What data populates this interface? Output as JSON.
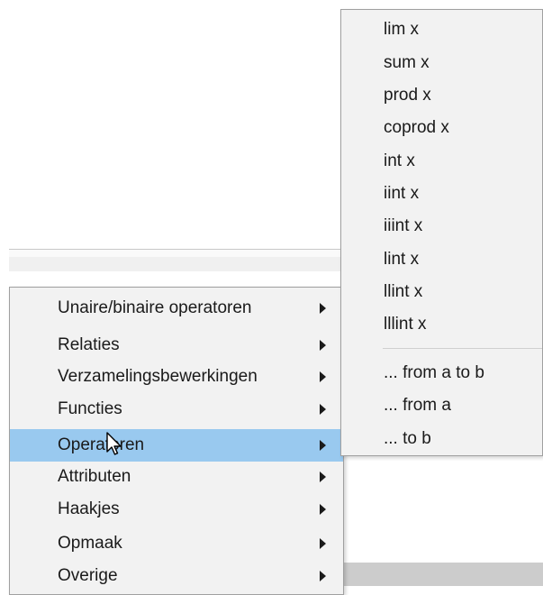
{
  "main_menu": {
    "items": [
      {
        "label": "Unaire/binaire operatoren",
        "has_submenu": true,
        "highlighted": false
      },
      {
        "label": "Relaties",
        "has_submenu": true,
        "highlighted": false
      },
      {
        "label": "Verzamelingsbewerkingen",
        "has_submenu": true,
        "highlighted": false
      },
      {
        "label": "Functies",
        "has_submenu": true,
        "highlighted": false
      },
      {
        "label": "Operatoren",
        "has_submenu": true,
        "highlighted": true
      },
      {
        "label": "Attributen",
        "has_submenu": true,
        "highlighted": false
      },
      {
        "label": "Haakjes",
        "has_submenu": true,
        "highlighted": false
      },
      {
        "label": "Opmaak",
        "has_submenu": true,
        "highlighted": false
      },
      {
        "label": "Overige",
        "has_submenu": true,
        "highlighted": false
      }
    ]
  },
  "operators_submenu": {
    "items": [
      {
        "label": "lim x"
      },
      {
        "label": "sum x"
      },
      {
        "label": "prod x"
      },
      {
        "label": "coprod x"
      },
      {
        "label": "int x"
      },
      {
        "label": "iint x"
      },
      {
        "label": "iiint x"
      },
      {
        "label": "lint x"
      },
      {
        "label": "llint x"
      },
      {
        "label": "lllint x"
      }
    ],
    "range_items": [
      {
        "label": "... from a to b"
      },
      {
        "label": "... from a"
      },
      {
        "label": "... to b"
      }
    ]
  },
  "colors": {
    "menu_background": "#f2f2f2",
    "highlight": "#99c9ef",
    "border": "#a0a0a0"
  },
  "icons": {
    "submenu_arrow": "triangle-right",
    "cursor": "arrow-pointer"
  }
}
